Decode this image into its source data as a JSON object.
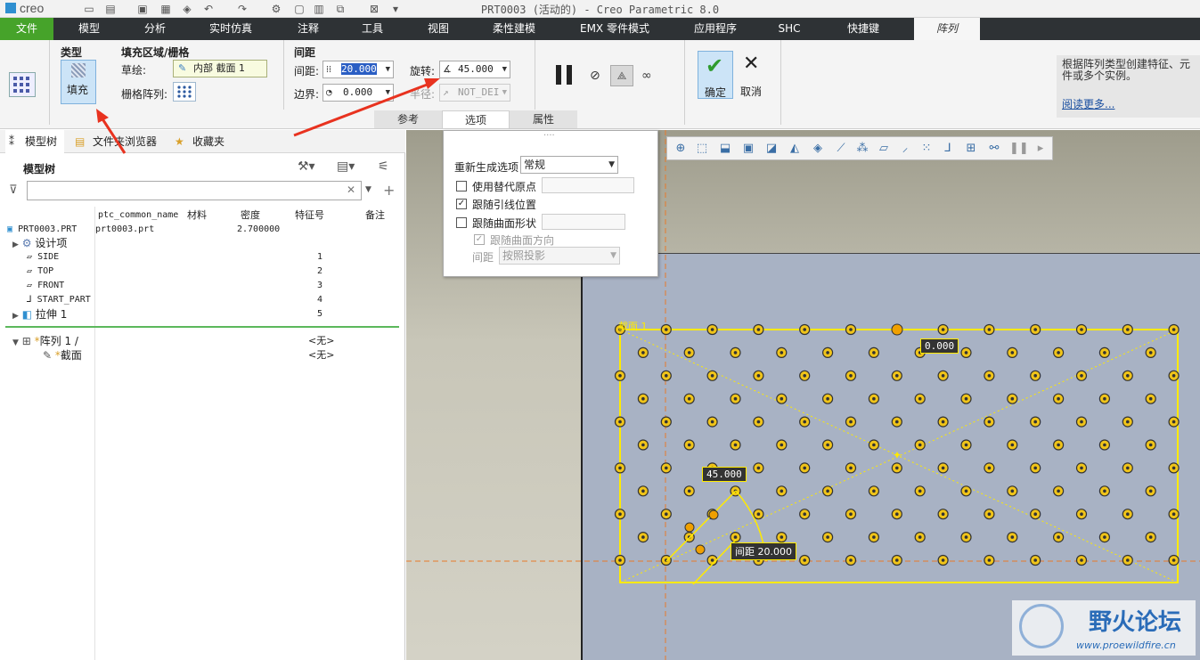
{
  "app": {
    "logo": "creo",
    "window_title": "PRT0003 (活动的) - Creo Parametric 8.0"
  },
  "menu_tabs": [
    "文件",
    "模型",
    "分析",
    "实时仿真",
    "注释",
    "工具",
    "视图",
    "柔性建模",
    "EMX 零件模式",
    "应用程序",
    "SHC",
    "快捷键",
    "阵列"
  ],
  "ribbon": {
    "type_group": {
      "title": "类型",
      "fill_label": "填充"
    },
    "fill_group": {
      "title": "填充区域/栅格",
      "sketch_label": "草绘:",
      "sketch_value": "内部 截面 1",
      "grid_label": "栅格阵列:"
    },
    "spacing_group": {
      "title": "间距",
      "spacing_label": "间距:",
      "spacing_value": "20.000",
      "border_label": "边界:",
      "border_value": "0.000",
      "rotation_label": "旋转:",
      "rotation_value": "45.000",
      "radius_label": "半径:",
      "radius_value": "NOT_DEI"
    },
    "confirm_label": "确定",
    "cancel_label": "取消",
    "subtabs": [
      "参考",
      "选项",
      "属性"
    ],
    "help_text": "根据阵列类型创建特征、元件或多个实例。",
    "help_link": "阅读更多..."
  },
  "options_panel": {
    "regen_label": "重新生成选项",
    "regen_value": "常规",
    "use_alt_origin": "使用替代原点",
    "follow_leader": "跟随引线位置",
    "follow_surface_shape": "跟随曲面形状",
    "follow_surface_dir": "跟随曲面方向",
    "spacing_label": "间距",
    "spacing_value": "按照投影"
  },
  "left_panel": {
    "tabs": [
      "模型树",
      "文件夹浏览器",
      "收藏夹"
    ],
    "title": "模型树",
    "columns": [
      "ptc_common_name",
      "材料",
      "密度",
      "特征号",
      "备注"
    ],
    "rows": [
      {
        "name": "PRT0003.PRT",
        "common": "prt0003.prt",
        "density": "2.700000",
        "fid": ""
      },
      {
        "name": "设计项",
        "common": "",
        "density": "",
        "fid": ""
      },
      {
        "name": "SIDE",
        "common": "",
        "density": "",
        "fid": "1"
      },
      {
        "name": "TOP",
        "common": "",
        "density": "",
        "fid": "2"
      },
      {
        "name": "FRONT",
        "common": "",
        "density": "",
        "fid": "3"
      },
      {
        "name": "START_PART",
        "common": "",
        "density": "",
        "fid": "4"
      },
      {
        "name": "拉伸 1",
        "common": "",
        "density": "",
        "fid": "5"
      }
    ],
    "insert_rows": [
      {
        "name": "阵列 1 /",
        "note": "<无>"
      },
      {
        "name": "截面",
        "note": "<无>"
      }
    ]
  },
  "viewport": {
    "section_label": "截面 1",
    "dim_zero": "0.000",
    "dim_angle": "45.000",
    "dim_spacing": "间距 20.000",
    "watermark_text": "野火论坛",
    "watermark_url": "www.proewildfire.cn"
  },
  "colors": {
    "accent_green": "#46a32a",
    "pattern_yellow": "#ffea00",
    "arrow_red": "#e8321f"
  }
}
